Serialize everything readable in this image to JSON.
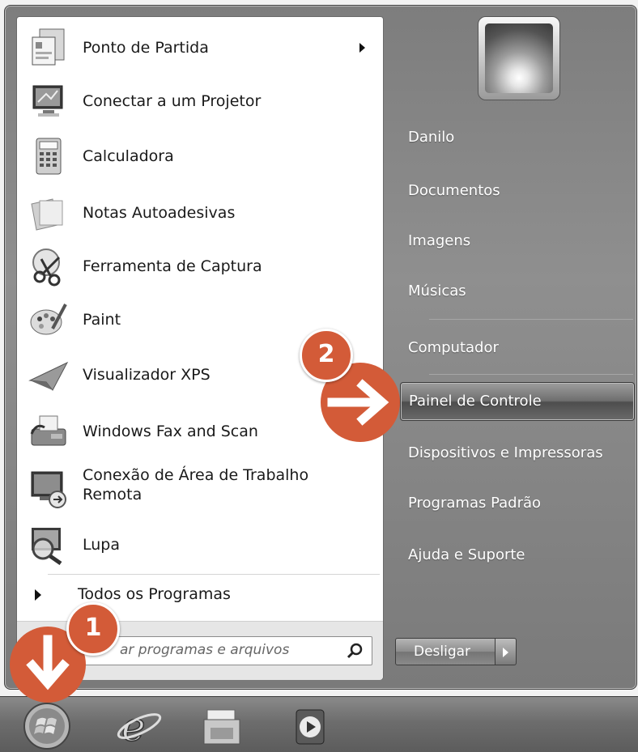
{
  "programs": [
    {
      "label": "Ponto de Partida",
      "icon": "getting-started-icon",
      "has_submenu": true
    },
    {
      "label": "Conectar a um Projetor",
      "icon": "projector-icon"
    },
    {
      "label": "Calculadora",
      "icon": "calculator-icon"
    },
    {
      "label": "Notas Autoadesivas",
      "icon": "sticky-notes-icon"
    },
    {
      "label": "Ferramenta de Captura",
      "icon": "snipping-tool-icon"
    },
    {
      "label": "Paint",
      "icon": "paint-icon"
    },
    {
      "label": "Visualizador XPS",
      "icon": "xps-viewer-icon"
    },
    {
      "label": "Windows Fax and Scan",
      "icon": "fax-scan-icon"
    },
    {
      "label_line1": "Conexão de Área de Trabalho",
      "label_line2": "Remota",
      "icon": "remote-desktop-icon"
    },
    {
      "label": "Lupa",
      "icon": "magnifier-icon"
    }
  ],
  "all_programs_label": "Todos os Programas",
  "search": {
    "placeholder_visible": "ar programas e arquivos"
  },
  "right_items": [
    {
      "label": "Danilo"
    },
    {
      "label": "Documentos"
    },
    {
      "label": "Imagens"
    },
    {
      "label": "Músicas"
    },
    {
      "label": "Computador"
    },
    {
      "label": "Painel de Controle",
      "highlighted": true
    },
    {
      "label": "Dispositivos e Impressoras"
    },
    {
      "label": "Programas Padrão"
    },
    {
      "label": "Ajuda e Suporte"
    }
  ],
  "shutdown_label": "Desligar",
  "callouts": [
    "1",
    "2"
  ],
  "taskbar_icons": [
    "start-orb-icon",
    "internet-explorer-icon",
    "file-explorer-icon",
    "media-player-icon"
  ],
  "colors": {
    "callout": "#d35b38",
    "highlight": "#6f6f6f"
  }
}
